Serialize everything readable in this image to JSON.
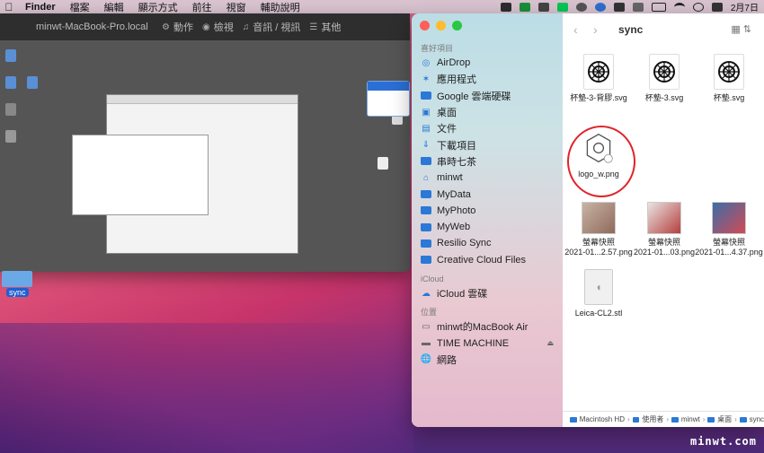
{
  "menubar": {
    "app_name": "Finder",
    "menus": [
      "檔案",
      "編輯",
      "顯示方式",
      "前往",
      "視窗",
      "輔助說明"
    ],
    "date": "2月7日"
  },
  "remote": {
    "title": "minwt-MacBook-Pro.local",
    "actions": [
      "動作",
      "檢視",
      "音訊 / 視訊",
      "其他"
    ]
  },
  "desktop": {
    "folder_label": "sync"
  },
  "finder": {
    "folder_title": "sync",
    "sections": {
      "favorites": "喜好項目",
      "icloud": "iCloud",
      "locations": "位置"
    },
    "favorites": [
      {
        "label": "AirDrop",
        "icon": "airdrop-icon"
      },
      {
        "label": "應用程式",
        "icon": "applications-icon"
      },
      {
        "label": "Google 雲端硬碟",
        "icon": "folder-icon"
      },
      {
        "label": "桌面",
        "icon": "desktop-icon"
      },
      {
        "label": "文件",
        "icon": "document-icon"
      },
      {
        "label": "下載項目",
        "icon": "download-icon"
      },
      {
        "label": "串時七茶",
        "icon": "folder-icon"
      },
      {
        "label": "minwt",
        "icon": "home-icon"
      },
      {
        "label": "MyData",
        "icon": "folder-icon"
      },
      {
        "label": "MyPhoto",
        "icon": "folder-icon"
      },
      {
        "label": "MyWeb",
        "icon": "folder-icon"
      },
      {
        "label": "Resilio Sync",
        "icon": "folder-icon"
      },
      {
        "label": "Creative Cloud Files",
        "icon": "folder-icon"
      }
    ],
    "icloud": [
      {
        "label": "iCloud 雲碟",
        "icon": "cloud-icon"
      }
    ],
    "locations": [
      {
        "label": "minwt的MacBook Air",
        "icon": "laptop-icon"
      },
      {
        "label": "TIME MACHINE",
        "icon": "drive-icon"
      },
      {
        "label": "網路",
        "icon": "network-icon"
      }
    ],
    "files": [
      {
        "name": "杯墊-3-背膠.svg",
        "kind": "svg"
      },
      {
        "name": "杯墊-3.svg",
        "kind": "svg"
      },
      {
        "name": "杯墊.svg",
        "kind": "svg"
      },
      {
        "name": "logo_w.png",
        "kind": "logo"
      },
      {
        "name": "螢幕快照",
        "name2": "2021-01...2.57.png",
        "kind": "photo1"
      },
      {
        "name": "螢幕快照",
        "name2": "2021-01...03.png",
        "kind": "photo2"
      },
      {
        "name": "螢幕快照",
        "name2": "2021-01...4.37.png",
        "kind": "photo3"
      },
      {
        "name": "Leica-CL2.stl",
        "kind": "stl"
      }
    ],
    "path": [
      "Macintosh HD",
      "使用者",
      "minwt",
      "桌面",
      "sync"
    ]
  },
  "watermark": "minwt.com",
  "colors": {
    "accent": "#2b78d6",
    "highlight": "#e0242a"
  }
}
